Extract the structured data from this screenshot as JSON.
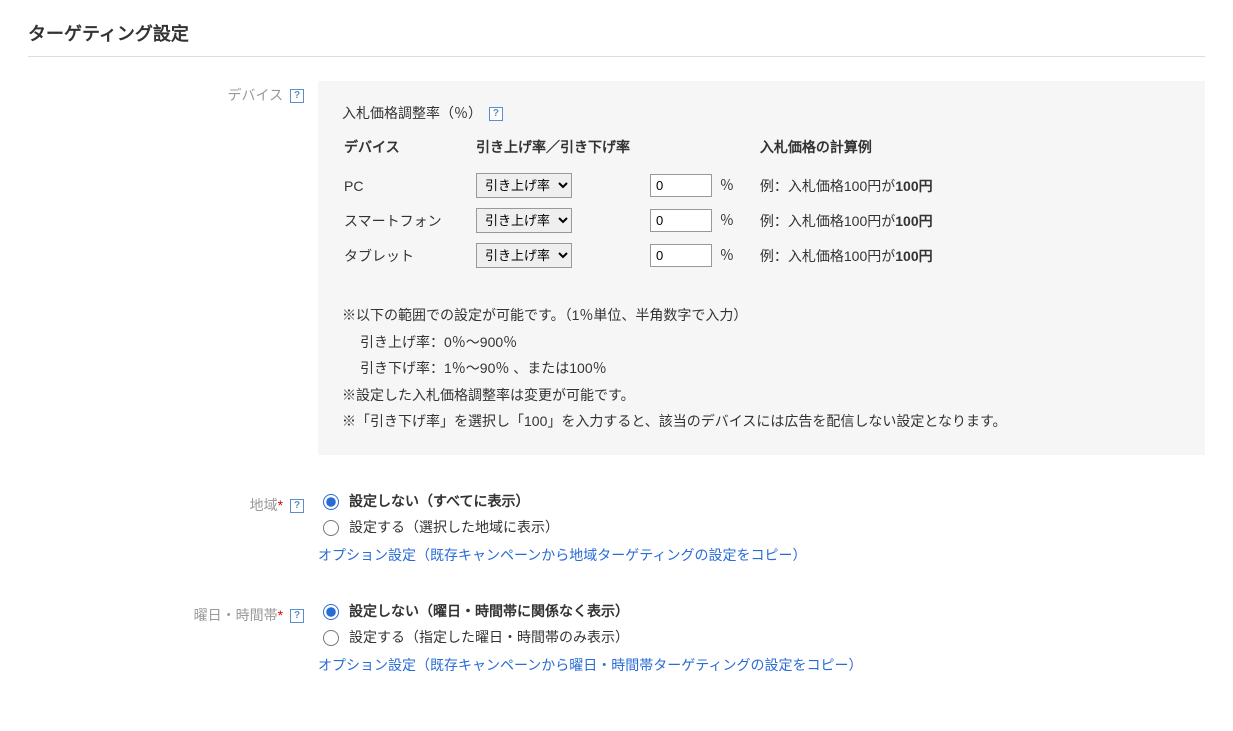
{
  "section_title": "ターゲティング設定",
  "device": {
    "label": "デバイス",
    "panel_title": "入札価格調整率（％）",
    "table": {
      "headers": {
        "device": "デバイス",
        "rate": "引き上げ率／引き下げ率",
        "calc": "入札価格の計算例"
      },
      "rows": [
        {
          "name": "PC",
          "select": "引き上げ率",
          "value": "0",
          "calc_prefix": "例：入札価格100円が",
          "calc_result": "100円"
        },
        {
          "name": "スマートフォン",
          "select": "引き上げ率",
          "value": "0",
          "calc_prefix": "例：入札価格100円が",
          "calc_result": "100円"
        },
        {
          "name": "タブレット",
          "select": "引き上げ率",
          "value": "0",
          "calc_prefix": "例：入札価格100円が",
          "calc_result": "100円"
        }
      ],
      "pct_label": "％"
    },
    "notes": {
      "line1": "※以下の範囲での設定が可能です。（1％単位、半角数字で入力）",
      "line2": "引き上げ率：0％～900％",
      "line3": "引き下げ率：1％～90％ 、または100％",
      "line4": "※設定した入札価格調整率は変更が可能です。",
      "line5": "※「引き下げ率」を選択し「100」を入力すると、該当のデバイスには広告を配信しない設定となります。"
    }
  },
  "region": {
    "label": "地域",
    "opt1": "設定しない（すべてに表示）",
    "opt2": "設定する（選択した地域に表示）",
    "link": "オプション設定（既存キャンペーンから地域ターゲティングの設定をコピー）"
  },
  "schedule": {
    "label": "曜日・時間帯",
    "opt1": "設定しない（曜日・時間帯に関係なく表示）",
    "opt2": "設定する（指定した曜日・時間帯のみ表示）",
    "link": "オプション設定（既存キャンペーンから曜日・時間帯ターゲティングの設定をコピー）"
  }
}
